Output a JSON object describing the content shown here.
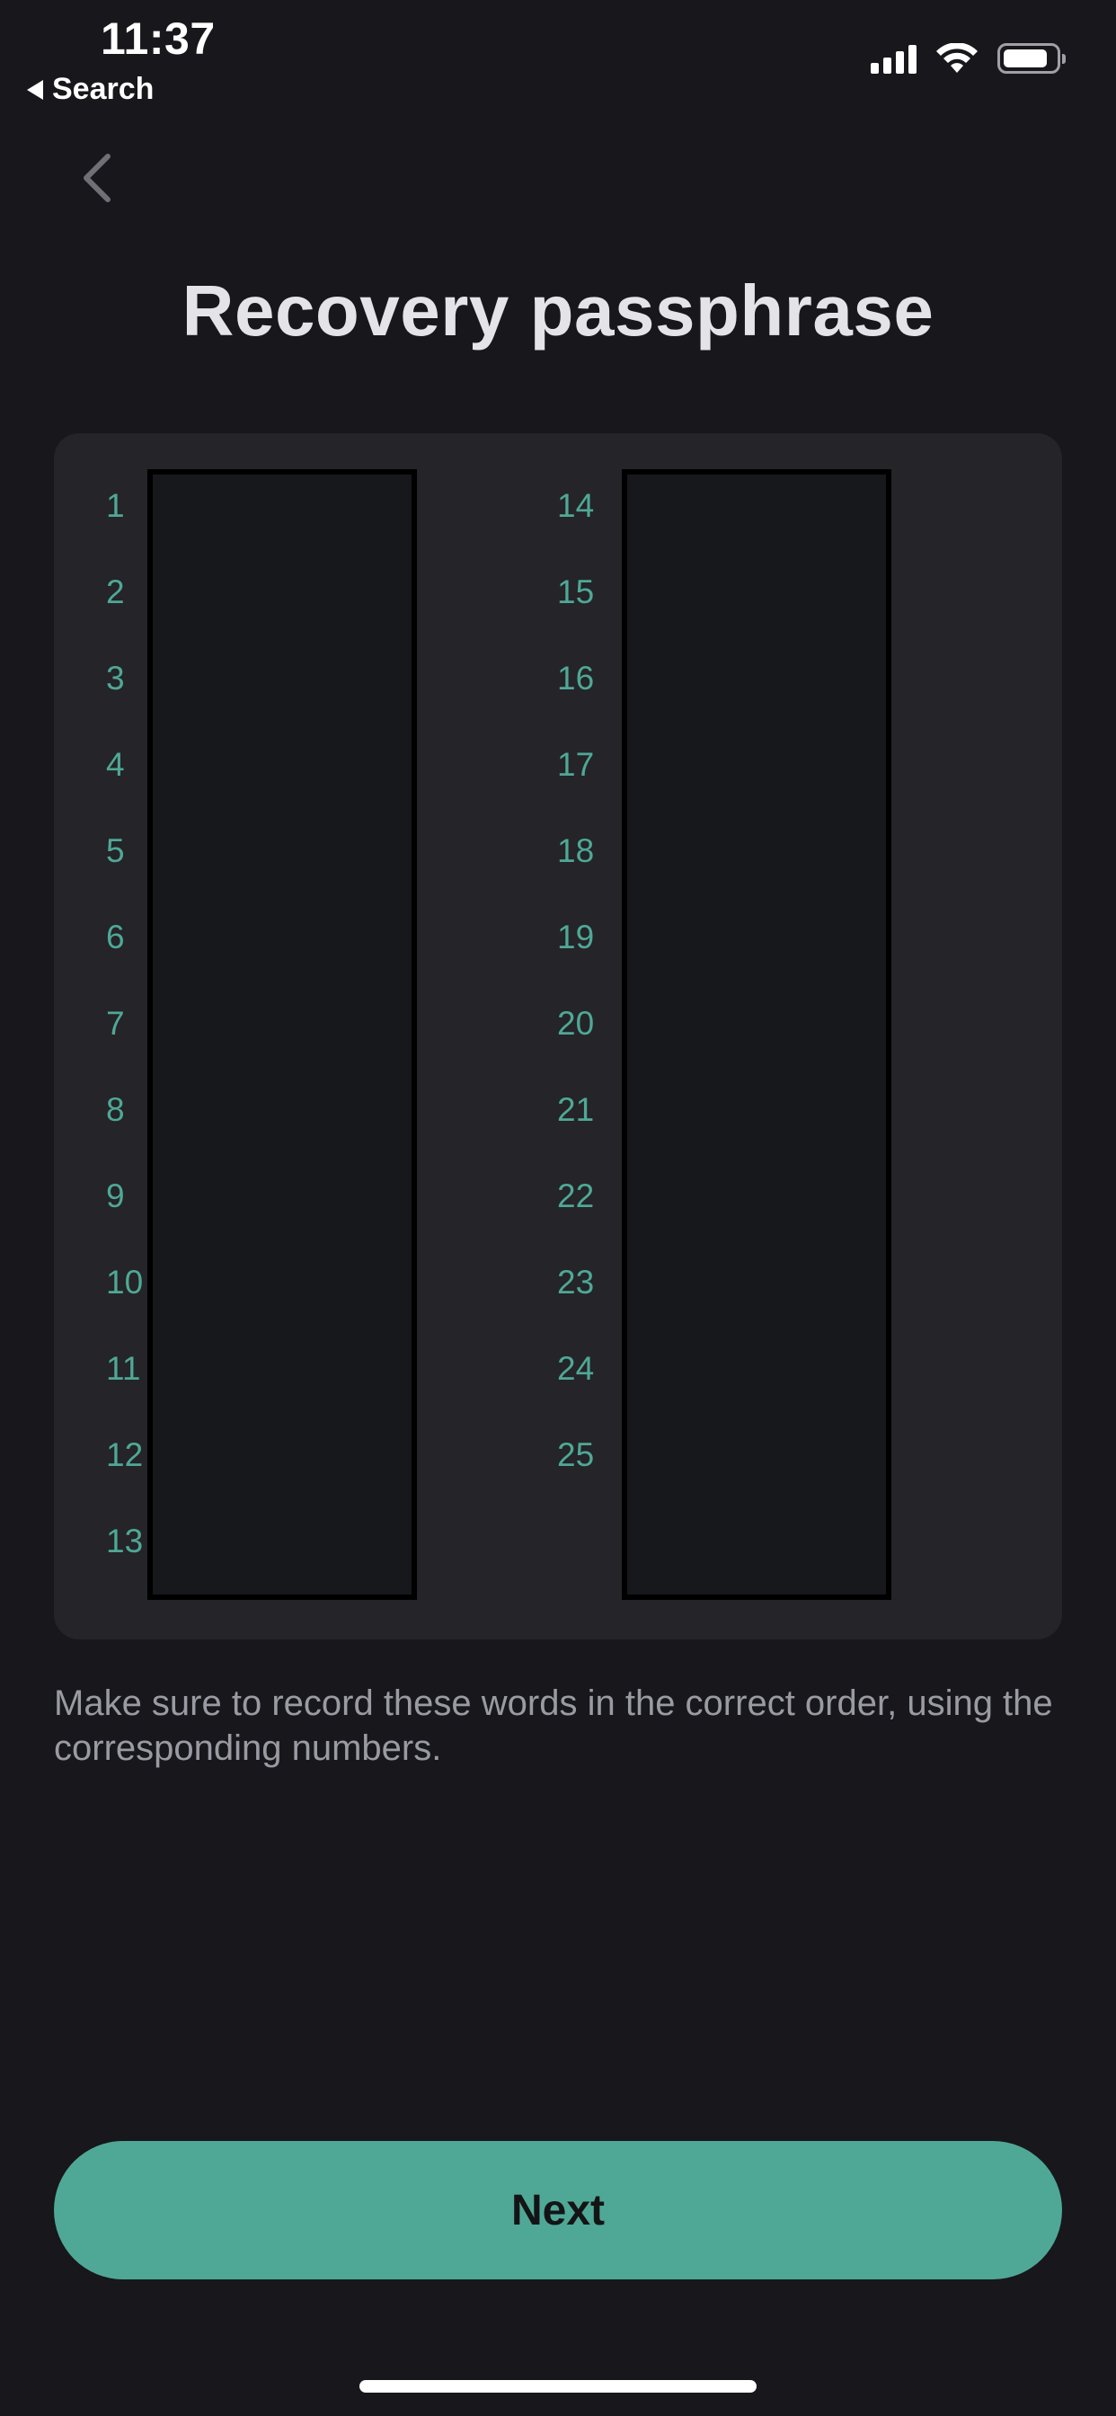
{
  "status_bar": {
    "time": "11:37",
    "back_label": "Search",
    "battery_level": 0.85,
    "icons": [
      "signal-icon",
      "wifi-icon",
      "battery-icon"
    ]
  },
  "nav": {
    "back_icon": "chevron-left-icon"
  },
  "title": "Recovery passphrase",
  "passphrase": {
    "left_numbers": [
      "1",
      "2",
      "3",
      "4",
      "5",
      "6",
      "7",
      "8",
      "9",
      "10",
      "11",
      "12",
      "13"
    ],
    "right_numbers": [
      "14",
      "15",
      "16",
      "17",
      "18",
      "19",
      "20",
      "21",
      "22",
      "23",
      "24",
      "25"
    ]
  },
  "instructions": "Make sure to record these words in the correct order, using the corresponding numbers.",
  "next_button": {
    "label": "Next"
  },
  "colors": {
    "background": "#17171c",
    "card": "#242429",
    "accent": "#4fa896",
    "muted_text": "#9a9aa2"
  }
}
